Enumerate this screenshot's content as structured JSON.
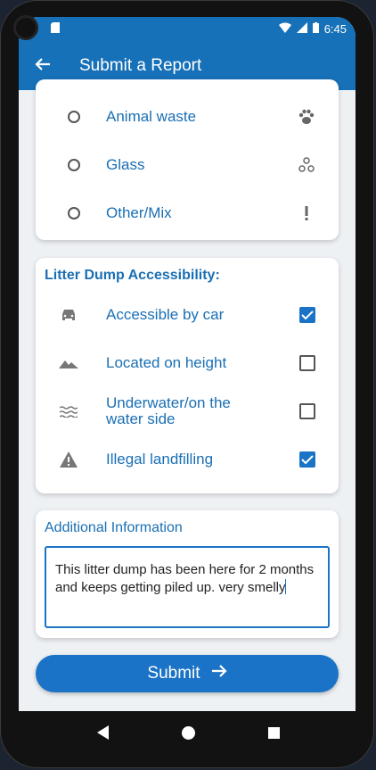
{
  "statusbar": {
    "time": "6:45"
  },
  "appbar": {
    "title": "Submit a Report"
  },
  "litter_types": [
    {
      "label": "Animal waste",
      "icon": "paw-icon",
      "selected": false
    },
    {
      "label": "Glass",
      "icon": "glass-bubbles-icon",
      "selected": false
    },
    {
      "label": "Other/Mix",
      "icon": "exclamation-icon",
      "selected": false
    }
  ],
  "accessibility": {
    "title": "Litter Dump Accessibility:",
    "items": [
      {
        "label": "Accessible by car",
        "icon": "car-icon",
        "checked": true
      },
      {
        "label": "Located on height",
        "icon": "mountain-icon",
        "checked": false
      },
      {
        "label_line1": "Underwater/on the",
        "label_line2": "water side",
        "icon": "water-icon",
        "checked": false
      },
      {
        "label": "Illegal landfilling",
        "icon": "warning-icon",
        "checked": true
      }
    ]
  },
  "additional": {
    "title": "Additional Information",
    "text": "This litter dump has been here for 2 months and keeps getting piled up. very smelly"
  },
  "submit": {
    "label": "Submit"
  },
  "colors": {
    "primary": "#1a73c6",
    "appbar": "#1771b8",
    "label": "#1a6fb4"
  }
}
